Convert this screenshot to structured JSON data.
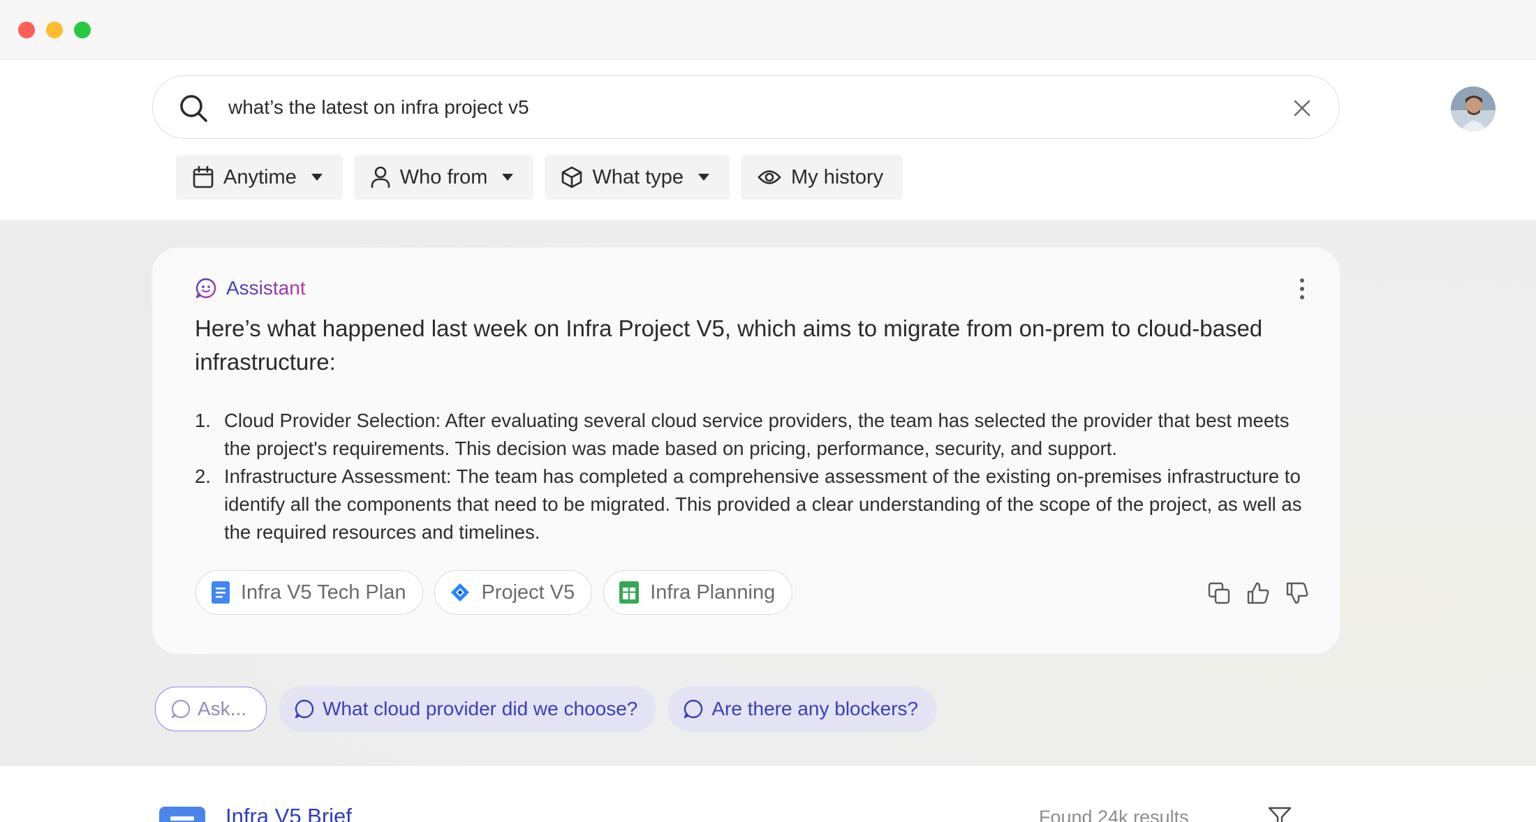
{
  "window": {
    "controls": [
      "close",
      "minimize",
      "maximize"
    ]
  },
  "search": {
    "query": "what’s the latest on infra project v5",
    "search_icon": "search-icon",
    "clear_icon": "close-icon"
  },
  "filters": {
    "anytime": "Anytime",
    "who_from": "Who from",
    "what_type": "What type",
    "my_history": "My history"
  },
  "assistant": {
    "label": "Assistant",
    "headline": "Here’s what happened last week on Infra Project V5, which aims to migrate from on-prem to cloud-based infrastructure:",
    "items": [
      {
        "num": "1.",
        "text": "Cloud Provider Selection: After evaluating several cloud service providers, the team has selected the provider that best meets the project's requirements. This decision was made based on pricing, performance, security, and support."
      },
      {
        "num": "2.",
        "text": "Infrastructure Assessment: The team has completed a comprehensive assessment of the existing on-premises infrastructure to identify all the components that need to be migrated. This provided a clear understanding of the scope of the project, as well as the required resources and timelines."
      }
    ],
    "sources": [
      {
        "label": "Infra V5 Tech Plan",
        "icon": "google-docs-icon"
      },
      {
        "label": "Project V5",
        "icon": "jira-icon"
      },
      {
        "label": "Infra Planning",
        "icon": "google-sheets-icon"
      }
    ],
    "actions": [
      "copy-icon",
      "thumbs-up-icon",
      "thumbs-down-icon"
    ]
  },
  "suggestions": {
    "ask": "Ask...",
    "items": [
      "What cloud provider did we choose?",
      "Are there any blockers?"
    ]
  },
  "results": {
    "first_title": "Infra V5 Brief",
    "count_text": "Found 24k results"
  },
  "colors": {
    "accent": "#3a3fb8",
    "assistant_gradient_start": "#3b3fc8",
    "assistant_gradient_end": "#c1379a",
    "link": "#2f3cc0"
  }
}
